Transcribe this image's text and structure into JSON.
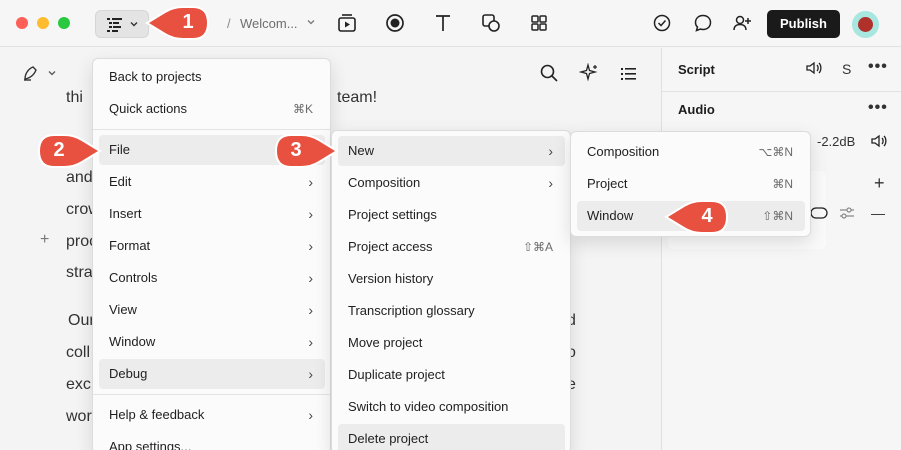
{
  "titlebar": {
    "breadcrumb_sep": "/",
    "breadcrumb": "Welcom...",
    "publish_label": "Publish",
    "icons": [
      "document-menu-icon",
      "chevron-down-icon",
      "layers-play-icon",
      "record-icon",
      "text-tool-icon",
      "shapes-icon",
      "grid-icon",
      "check-circle-icon",
      "comment-icon",
      "add-user-icon"
    ]
  },
  "editor": {
    "lines": [
      "thi",
      "team!",
      "and",
      "crow",
      "proc",
      "stra",
      "Our",
      "coll",
      "exc",
      "wor",
      "d",
      "o",
      "e"
    ],
    "add_glyph": "+"
  },
  "panel": {
    "script_title": "Script",
    "script_s": "S",
    "dots": "•••",
    "audio_title": "Audio",
    "gain": "-2.2dB",
    "plus": "+",
    "minus": "—"
  },
  "main_menu": {
    "items": [
      {
        "label": "Back to projects"
      },
      {
        "label": "Quick actions",
        "shortcut": "⌘K"
      },
      {
        "label": "File"
      },
      {
        "label": "Edit"
      },
      {
        "label": "Insert"
      },
      {
        "label": "Format"
      },
      {
        "label": "Controls"
      },
      {
        "label": "View"
      },
      {
        "label": "Window"
      },
      {
        "label": "Debug"
      },
      {
        "label": "Help & feedback"
      },
      {
        "label": "App settings..."
      }
    ],
    "arrow": "›"
  },
  "file_menu": {
    "items": [
      {
        "label": "New"
      },
      {
        "label": "Composition"
      },
      {
        "label": "Project settings"
      },
      {
        "label": "Project access",
        "shortcut": "⇧⌘A"
      },
      {
        "label": "Version history"
      },
      {
        "label": "Transcription glossary"
      },
      {
        "label": "Move project"
      },
      {
        "label": "Duplicate project"
      },
      {
        "label": "Switch to video composition"
      },
      {
        "label": "Delete project"
      }
    ]
  },
  "new_menu": {
    "items": [
      {
        "label": "Composition",
        "shortcut": "⌥⌘N"
      },
      {
        "label": "Project",
        "shortcut": "⌘N"
      },
      {
        "label": "Window",
        "shortcut": "⇧⌘N"
      }
    ]
  },
  "badges": [
    "1",
    "2",
    "3",
    "4"
  ],
  "colors": {
    "badge": "#e8503f",
    "publish": "#1a1a1a",
    "highlight": "#ececec"
  }
}
